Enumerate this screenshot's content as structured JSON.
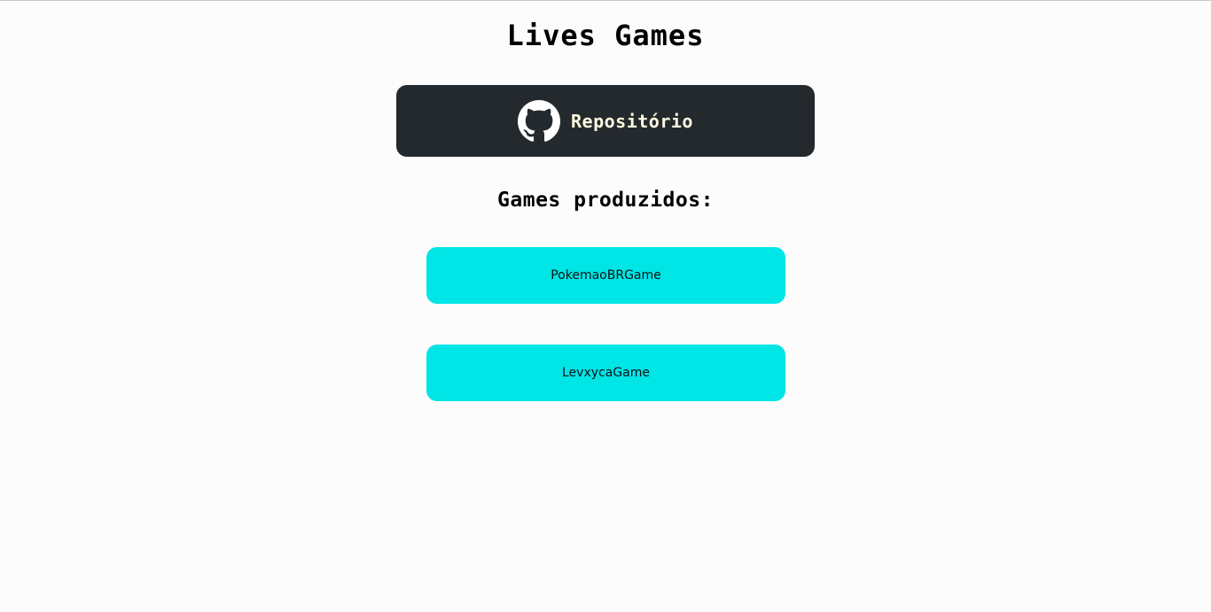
{
  "header": {
    "title": "Lives Games"
  },
  "repo": {
    "label": "Repositório",
    "icon": "github-icon",
    "colors": {
      "background": "#24292e",
      "text": "#fffbe0"
    }
  },
  "games": {
    "heading": "Games produzidos:",
    "items": [
      {
        "label": "PokemaoBRGame"
      },
      {
        "label": "LevxycaGame"
      }
    ],
    "colors": {
      "button_background": "#00e5e6"
    }
  }
}
